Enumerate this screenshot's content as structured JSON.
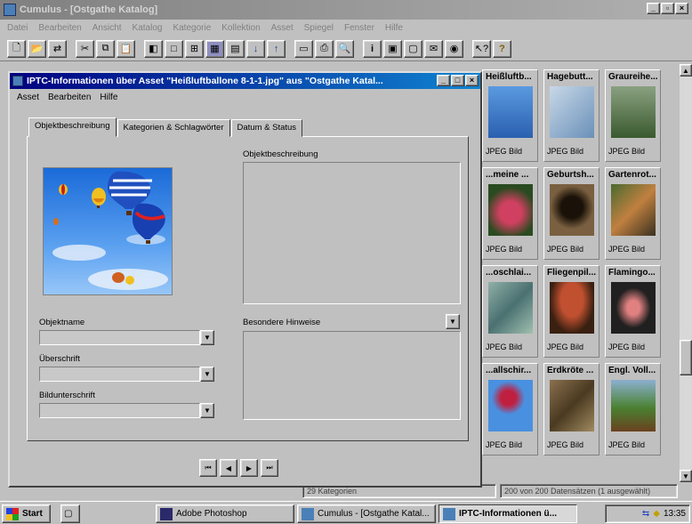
{
  "main_window": {
    "title": "Cumulus - [Ostgathe Katalog]",
    "menu": [
      "Datei",
      "Bearbeiten",
      "Ansicht",
      "Katalog",
      "Kategorie",
      "Kollektion",
      "Asset",
      "Spiegel",
      "Fenster",
      "Hilfe"
    ],
    "toolbar_icons": [
      "new-icon",
      "open-icon",
      "import-icon",
      "cut-icon",
      "copy-icon",
      "paste-icon",
      "layout1-icon",
      "layout2-icon",
      "grid-icon",
      "list-icon",
      "details-icon",
      "sort-asc-icon",
      "sort-desc-icon",
      "view-icon",
      "print-icon",
      "find-icon",
      "info-icon",
      "catalog-icon",
      "preview-icon",
      "mail-icon",
      "web-icon",
      "help-icon",
      "question-icon"
    ]
  },
  "dialog": {
    "title": "IPTC-Informationen über Asset \"Heißluftballone 8-1-1.jpg\" aus \"Ostgathe Katal...",
    "menu": [
      "Asset",
      "Bearbeiten",
      "Hilfe"
    ],
    "tabs": [
      "Objektbeschreibung",
      "Kategorien & Schlagwörter",
      "Datum & Status"
    ],
    "active_tab": "Objektbeschreibung",
    "labels": {
      "object_description": "Objektbeschreibung",
      "object_name": "Objektname",
      "headline": "Überschrift",
      "caption": "Bildunterschrift",
      "special_instructions": "Besondere Hinweise"
    },
    "nav_buttons": [
      "first-record",
      "previous-record",
      "next-record",
      "last-record"
    ]
  },
  "assets": [
    {
      "name": "Heißluftb...",
      "type": "JPEG Bild",
      "color": "#4a8ad0"
    },
    {
      "name": "Hagebutt...",
      "type": "JPEG Bild",
      "color": "#a8c0d8"
    },
    {
      "name": "Graureihe...",
      "type": "JPEG Bild",
      "color": "#6a8a5a"
    },
    {
      "name": "...meine ...",
      "type": "JPEG Bild",
      "color": "#b03050"
    },
    {
      "name": "Geburtsh...",
      "type": "JPEG Bild",
      "color": "#6a5030"
    },
    {
      "name": "Gartenrot...",
      "type": "JPEG Bild",
      "color": "#8a6a40"
    },
    {
      "name": "...oschlai...",
      "type": "JPEG Bild",
      "color": "#7a9aa0"
    },
    {
      "name": "Fliegenpil...",
      "type": "JPEG Bild",
      "color": "#a04020"
    },
    {
      "name": "Flamingo...",
      "type": "JPEG Bild",
      "color": "#303030"
    },
    {
      "name": "...allschir...",
      "type": "JPEG Bild",
      "color": "#3a80d0"
    },
    {
      "name": "Erdkröte ...",
      "type": "JPEG Bild",
      "color": "#806040"
    },
    {
      "name": "Engl. Voll...",
      "type": "JPEG Bild",
      "color": "#4a8030"
    }
  ],
  "status": {
    "categories": "29 Kategorien",
    "records": "200 von 200 Datensätzen (1 ausgewählt)"
  },
  "taskbar": {
    "start": "Start",
    "items": [
      "Adobe Photoshop",
      "Cumulus - [Ostgathe Katal...",
      "IPTC-Informationen ü..."
    ],
    "clock": "13:35"
  }
}
